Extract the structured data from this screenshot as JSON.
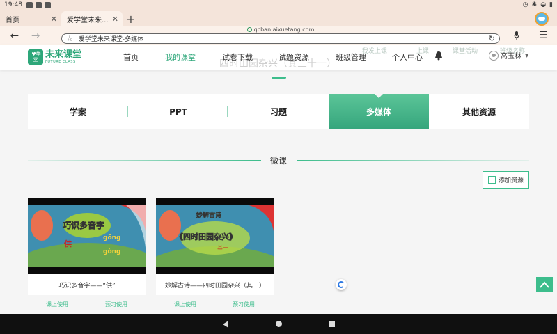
{
  "status_bar": {
    "time": "19:48"
  },
  "browser": {
    "tabs": [
      {
        "label": "首页",
        "active": false
      },
      {
        "label": "爱学堂未来...",
        "active": true
      }
    ],
    "new_tab": "+",
    "url_host": "qcban.aixuetang.com",
    "url_text": "爱学堂未来课堂-多媒体"
  },
  "site": {
    "logo_mark": "I♥学堂",
    "logo_title": "未来课堂",
    "logo_subtitle": "FUTURE CLASS",
    "nav": [
      {
        "label": "首页",
        "active": false
      },
      {
        "label": "我的课堂",
        "active": true
      },
      {
        "label": "试卷下载",
        "active": false
      },
      {
        "label": "试题资源",
        "active": false
      },
      {
        "label": "班级管理",
        "active": false
      },
      {
        "label": "个人中心",
        "active": false
      }
    ],
    "user_name": "高玉林",
    "ghost": {
      "title": "四时田园杂兴（其三十一）",
      "items": [
        "我发上课",
        "上课",
        "课堂活动",
        "班级名称"
      ]
    }
  },
  "category_tabs": [
    {
      "label": "学案",
      "active": false
    },
    {
      "label": "PPT",
      "active": false
    },
    {
      "label": "习题",
      "active": false
    },
    {
      "label": "多媒体",
      "active": true
    },
    {
      "label": "其他资源",
      "active": false
    }
  ],
  "section_title": "微课",
  "add_resource_label": "添加资源",
  "cards": [
    {
      "title": "巧识多音字——“供”",
      "thumb_heading": "巧识多音字",
      "thumb_words": [
        "gōng",
        "gòng",
        "供"
      ],
      "action_class": "课上使用",
      "action_preview": "预习使用"
    },
    {
      "title": "妙解古诗——四时田园杂兴（其一）",
      "thumb_badge": "妙解古诗",
      "thumb_heading": "《四时田园杂兴》",
      "thumb_sub": "其一",
      "action_class": "课上使用",
      "action_preview": "预习使用"
    }
  ],
  "colors": {
    "accent": "#3dbd8c",
    "browser_chrome": "#f4e4da"
  }
}
